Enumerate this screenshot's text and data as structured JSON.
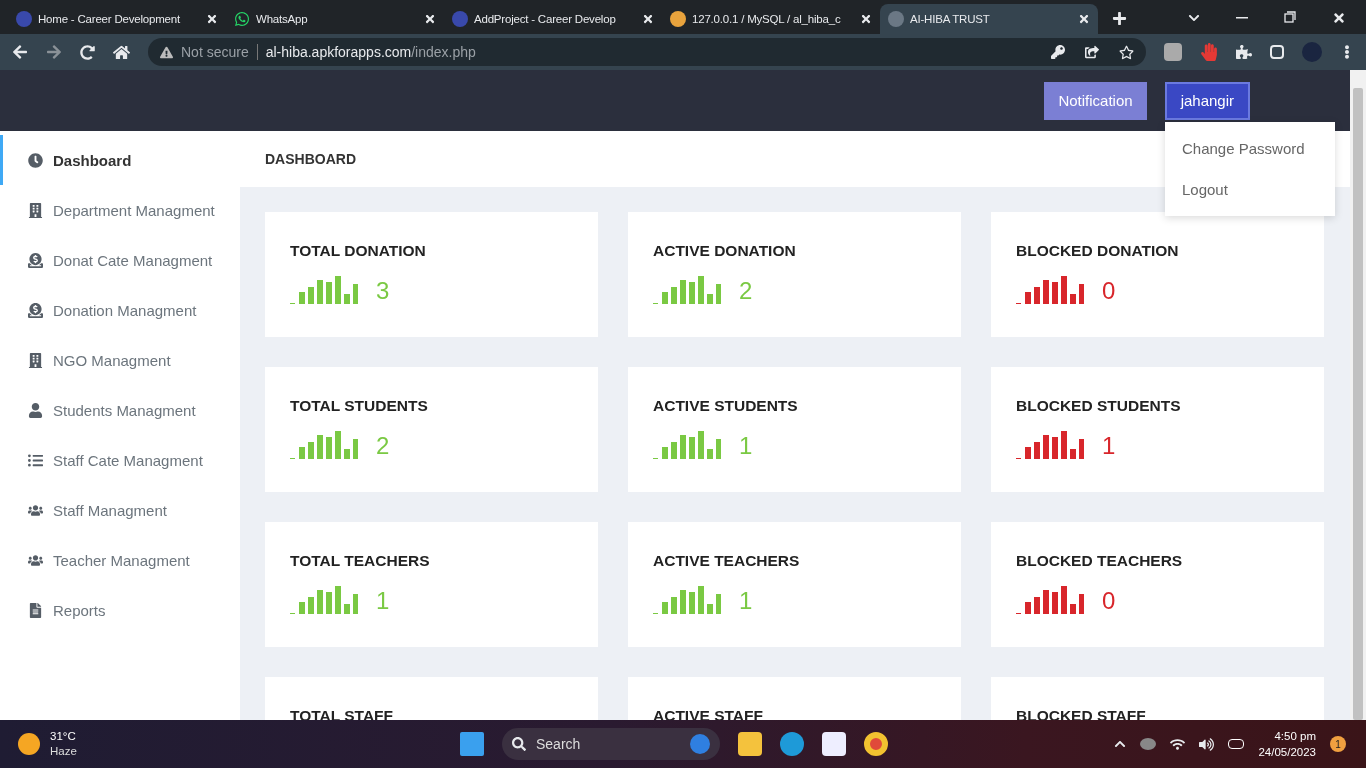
{
  "browser": {
    "tabs": [
      {
        "title": "Home - Career Development",
        "kind": "site",
        "selected": false
      },
      {
        "title": "WhatsApp",
        "kind": "chat",
        "selected": false
      },
      {
        "title": "AddProject - Career Develop",
        "kind": "site",
        "selected": false
      },
      {
        "title": "127.0.0.1 / MySQL / al_hiba_c",
        "kind": "database",
        "selected": false
      },
      {
        "title": "AI-HIBA TRUST",
        "kind": "app",
        "selected": true
      }
    ],
    "address": {
      "security": "Not secure",
      "host": "al-hiba.apkforapps.com",
      "path": "/index.php"
    }
  },
  "header": {
    "buttons": [
      {
        "label": "Notification",
        "selected": false
      },
      {
        "label": "jahangir",
        "selected": true
      }
    ]
  },
  "user_menu": {
    "items": [
      "Change Password",
      "Logout"
    ]
  },
  "sidebar": {
    "items": [
      {
        "label": "Dashboard",
        "kind": "dashboard",
        "selected": true
      },
      {
        "label": "Department Managment",
        "kind": "building",
        "selected": false
      },
      {
        "label": "Donat Cate Managment",
        "kind": "donation",
        "selected": false
      },
      {
        "label": "Donation Managment",
        "kind": "donation",
        "selected": false
      },
      {
        "label": "NGO Managment",
        "kind": "building",
        "selected": false
      },
      {
        "label": "Students Managment",
        "kind": "person",
        "selected": false
      },
      {
        "label": "Staff Cate Managment",
        "kind": "list",
        "selected": false
      },
      {
        "label": "Staff Managment",
        "kind": "group",
        "selected": false
      },
      {
        "label": "Teacher Managment",
        "kind": "group",
        "selected": false
      },
      {
        "label": "Reports",
        "kind": "file",
        "selected": false
      }
    ]
  },
  "page_title": "DASHBOARD",
  "cards": [
    {
      "title": "TOTAL DONATION",
      "value": "3",
      "color": "#7ac943"
    },
    {
      "title": "ACTIVE DONATION",
      "value": "2",
      "color": "#7ac943"
    },
    {
      "title": "BLOCKED DONATION",
      "value": "0",
      "color": "#d8262b"
    },
    {
      "title": "TOTAL STUDENTS",
      "value": "2",
      "color": "#7ac943"
    },
    {
      "title": "ACTIVE STUDENTS",
      "value": "1",
      "color": "#7ac943"
    },
    {
      "title": "BLOCKED STUDENTS",
      "value": "1",
      "color": "#d8262b"
    },
    {
      "title": "TOTAL TEACHERS",
      "value": "1",
      "color": "#7ac943"
    },
    {
      "title": "ACTIVE TEACHERS",
      "value": "1",
      "color": "#7ac943"
    },
    {
      "title": "BLOCKED TEACHERS",
      "value": "0",
      "color": "#d8262b"
    },
    {
      "title": "TOTAL STAFF"
    },
    {
      "title": "ACTIVE STAFF"
    },
    {
      "title": "BLOCKED STAFF"
    }
  ],
  "taskbar": {
    "weather": {
      "temperature": "31°C",
      "condition": "Haze"
    },
    "search": {
      "placeholder": "Search"
    },
    "clock": {
      "time": "4:50 pm",
      "date": "24/05/2023"
    },
    "notification_count": "1"
  }
}
